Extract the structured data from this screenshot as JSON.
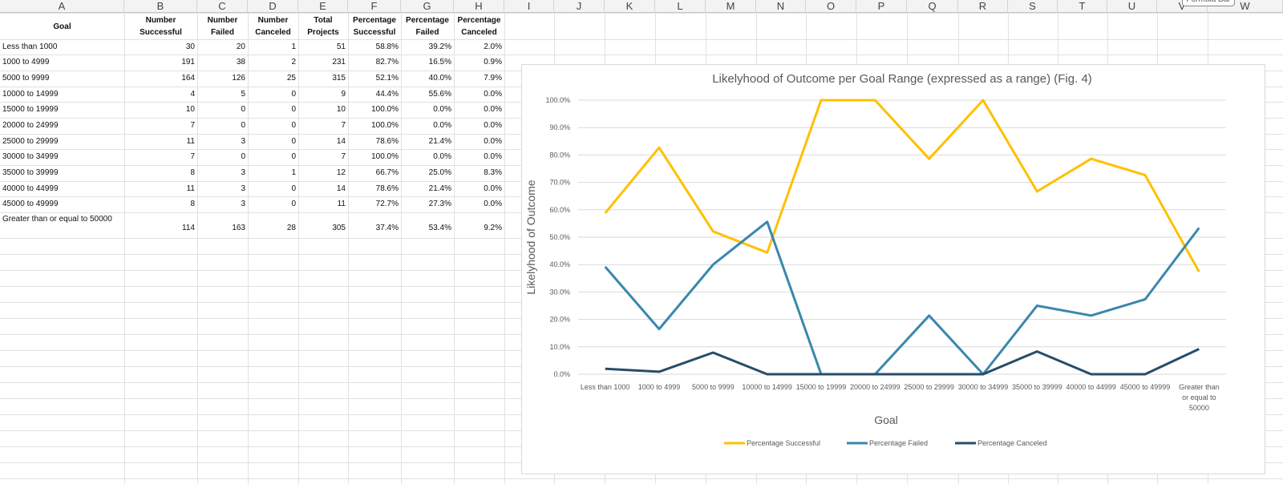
{
  "columns": [
    "A",
    "B",
    "C",
    "D",
    "E",
    "F",
    "G",
    "H",
    "I",
    "J",
    "K",
    "L",
    "M",
    "N",
    "O",
    "P",
    "Q",
    "R",
    "S",
    "T",
    "U",
    "V",
    "W"
  ],
  "formula_button": "Formula Bar",
  "table": {
    "headers": [
      "Goal",
      "Number Successful",
      "Number Failed",
      "Number Canceled",
      "Total Projects",
      "Percentage Successful",
      "Percentage Failed",
      "Percentage Canceled"
    ],
    "rows": [
      [
        "Less than 1000",
        "30",
        "20",
        "1",
        "51",
        "58.8%",
        "39.2%",
        "2.0%"
      ],
      [
        "1000 to 4999",
        "191",
        "38",
        "2",
        "231",
        "82.7%",
        "16.5%",
        "0.9%"
      ],
      [
        "5000 to 9999",
        "164",
        "126",
        "25",
        "315",
        "52.1%",
        "40.0%",
        "7.9%"
      ],
      [
        "10000 to 14999",
        "4",
        "5",
        "0",
        "9",
        "44.4%",
        "55.6%",
        "0.0%"
      ],
      [
        "15000 to 19999",
        "10",
        "0",
        "0",
        "10",
        "100.0%",
        "0.0%",
        "0.0%"
      ],
      [
        "20000 to 24999",
        "7",
        "0",
        "0",
        "7",
        "100.0%",
        "0.0%",
        "0.0%"
      ],
      [
        "25000 to 29999",
        "11",
        "3",
        "0",
        "14",
        "78.6%",
        "21.4%",
        "0.0%"
      ],
      [
        "30000 to 34999",
        "7",
        "0",
        "0",
        "7",
        "100.0%",
        "0.0%",
        "0.0%"
      ],
      [
        "35000 to 39999",
        "8",
        "3",
        "1",
        "12",
        "66.7%",
        "25.0%",
        "8.3%"
      ],
      [
        "40000 to 44999",
        "11",
        "3",
        "0",
        "14",
        "78.6%",
        "21.4%",
        "0.0%"
      ],
      [
        "45000 to 49999",
        "8",
        "3",
        "0",
        "11",
        "72.7%",
        "27.3%",
        "0.0%"
      ],
      [
        "Greater than or equal to 50000",
        "114",
        "163",
        "28",
        "305",
        "37.4%",
        "53.4%",
        "9.2%"
      ]
    ]
  },
  "chart_data": {
    "type": "line",
    "title": "Likelyhood of Outcome per Goal Range (expressed as a range) (Fig. 4)",
    "xlabel": "Goal",
    "ylabel": "Likelyhood of Outcome",
    "categories": [
      "Less than 1000",
      "1000 to 4999",
      "5000 to 9999",
      "10000 to 14999",
      "15000 to 19999",
      "20000 to 24999",
      "25000 to 29999",
      "30000 to 34999",
      "35000 to 39999",
      "40000 to 44999",
      "45000 to 49999",
      "Greater than or equal to 50000"
    ],
    "yticks": [
      "0.0%",
      "10.0%",
      "20.0%",
      "30.0%",
      "40.0%",
      "50.0%",
      "60.0%",
      "70.0%",
      "80.0%",
      "90.0%",
      "100.0%"
    ],
    "ylim": [
      0,
      100
    ],
    "grid": true,
    "legend_position": "bottom",
    "series": [
      {
        "name": "Percentage Successful",
        "color": "#ffc000",
        "values": [
          58.8,
          82.7,
          52.1,
          44.4,
          100,
          100,
          78.6,
          100,
          66.7,
          78.6,
          72.7,
          37.4
        ]
      },
      {
        "name": "Percentage Failed",
        "color": "#3a87ad",
        "values": [
          39.2,
          16.5,
          40.0,
          55.6,
          0,
          0,
          21.4,
          0,
          25.0,
          21.4,
          27.3,
          53.4
        ]
      },
      {
        "name": "Percentage Canceled",
        "color": "#264d6a",
        "values": [
          2.0,
          0.9,
          7.9,
          0,
          0,
          0,
          0,
          0,
          8.3,
          0,
          0,
          9.2
        ]
      }
    ]
  }
}
